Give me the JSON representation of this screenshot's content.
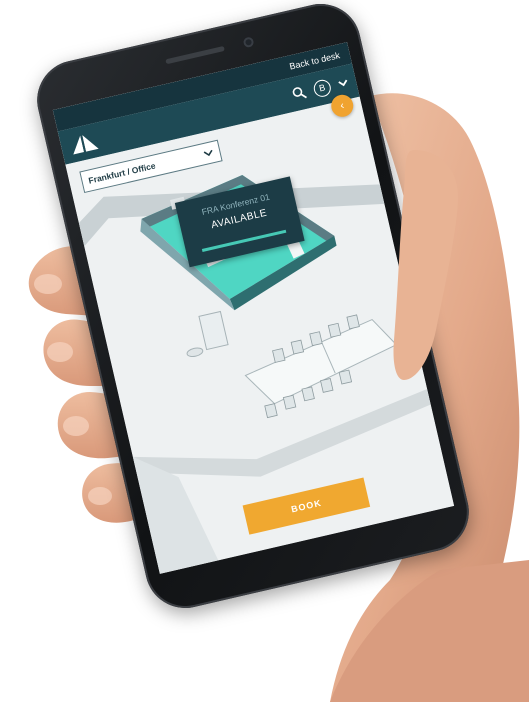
{
  "header": {
    "back_link": "Back to desk",
    "user_initial": "B"
  },
  "location": {
    "selected": "Frankfurt / Office"
  },
  "room": {
    "name": "FRA Konferenz 01",
    "status": "AVAILABLE"
  },
  "actions": {
    "book_label": "BOOK"
  },
  "colors": {
    "topbar": "#16343e",
    "navbar": "#1e4a55",
    "accent": "#f0a830",
    "room_highlight": "#4fd6c3",
    "available": "#46c9b5"
  },
  "icons": {
    "logo": "brand-logo-icon",
    "search": "search-icon",
    "menu": "chevron-down-icon",
    "collapse": "chevron-left-icon"
  }
}
